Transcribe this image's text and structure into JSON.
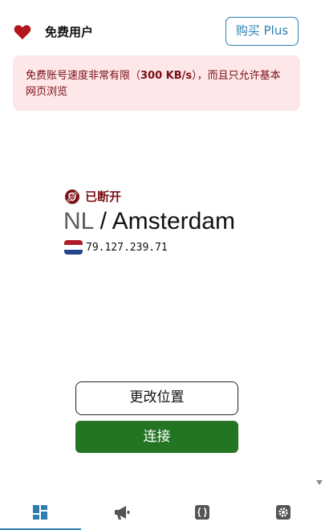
{
  "header": {
    "user_label": "免费用户",
    "buy_button": "购买 Plus"
  },
  "notice": {
    "text_before": "免费账号速度非常有限（",
    "speed": "300 KB/s",
    "text_after": "），而且只允许基本网页浏览"
  },
  "status": {
    "label": "已断开"
  },
  "location": {
    "country_code": "NL",
    "separator": " / ",
    "city": "Amsterdam",
    "flag_icon": "flag-nl-icon",
    "ip": "79.127.239.71"
  },
  "actions": {
    "change_location": "更改位置",
    "connect": "连接"
  },
  "nav": {
    "tabs": [
      {
        "icon": "dashboard-icon",
        "active": true
      },
      {
        "icon": "megaphone-icon",
        "active": false
      },
      {
        "icon": "code-braces-icon",
        "active": false
      },
      {
        "icon": "gear-icon",
        "active": false
      }
    ]
  },
  "colors": {
    "accent": "#2e7fb0",
    "danger": "#7a1218",
    "connect": "#237524",
    "notice_bg": "#fde7e9"
  }
}
